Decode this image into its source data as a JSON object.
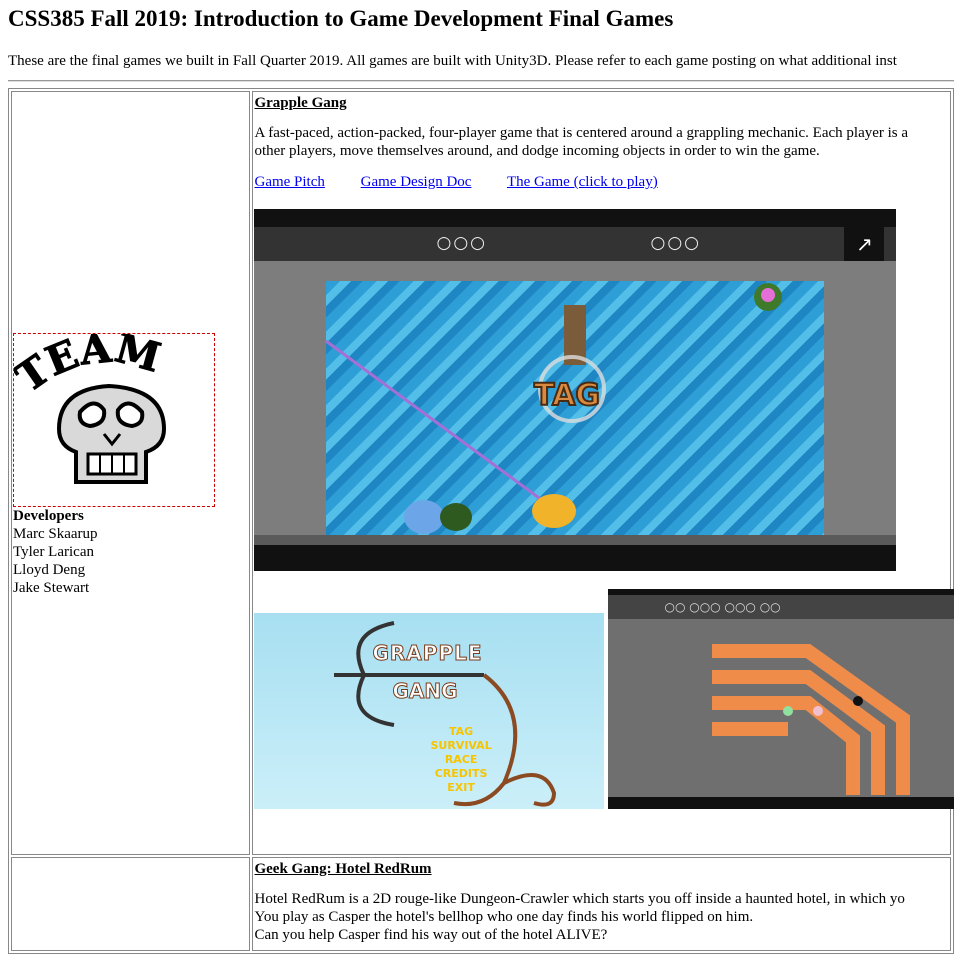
{
  "page": {
    "title": "CSS385 Fall 2019: Introduction to Game Development Final Games",
    "intro": "These are the final games we built in Fall Quarter 2019. All games are built with Unity3D. Please refer to each game posting on what additional inst"
  },
  "games": [
    {
      "logo_text": "TEAM",
      "developers_label": "Developers",
      "developers": [
        "Marc Skaarup",
        "Tyler Larican",
        "Lloyd Deng",
        "Jake Stewart"
      ],
      "title": "Grapple Gang",
      "description_line1": "A fast-paced, action-packed, four-player game that is centered around a grappling mechanic. Each player is a",
      "description_line2": "other players, move themselves around, and dodge incoming objects in order to win the game.",
      "links": [
        "Game Pitch",
        "Game Design Doc",
        "The Game (click to play)"
      ],
      "screenshot": {
        "mode_text": "TAG",
        "hud_left": "○○○",
        "hud_right": "○○○",
        "expand_icon": "↗"
      },
      "menu": {
        "title_line1": "GRAPPLE",
        "title_line2": "GANG",
        "items": [
          "TAG",
          "SURVIVAL",
          "RACE",
          "CREDITS",
          "EXIT"
        ]
      },
      "level_hud": "○○   ○○○   ○○○   ○○"
    },
    {
      "title": "Geek Gang: Hotel RedRum",
      "desc1": "Hotel RedRum is a 2D rouge-like Dungeon-Crawler which starts you off inside a haunted hotel, in which yo",
      "desc2": "You play as Casper the hotel's bellhop who one day finds his world flipped on him.",
      "desc3": "Can you help Casper find his way out of the hotel ALIVE?"
    }
  ]
}
